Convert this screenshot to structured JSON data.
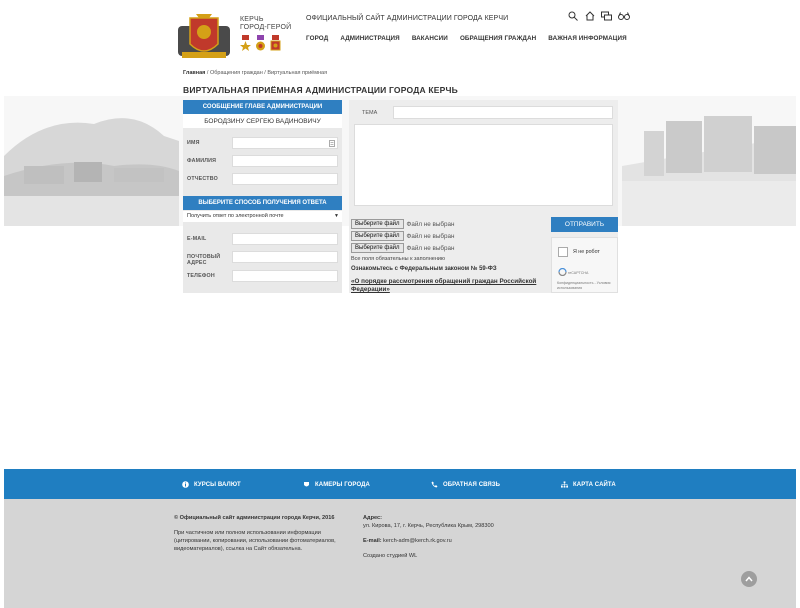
{
  "header": {
    "city_line1": "КЕРЧЬ",
    "city_line2": "ГОРОД-ГЕРОЙ",
    "site_title": "ОФИЦИАЛЬНЫЙ САЙТ АДМИНИСТРАЦИИ ГОРОДА КЕРЧИ",
    "nav": [
      "ГОРОД",
      "АДМИНИСТРАЦИЯ",
      "ВАКАНСИИ",
      "ОБРАЩЕНИЯ ГРАЖДАН",
      "ВАЖНАЯ ИНФОРМАЦИЯ"
    ]
  },
  "breadcrumb": {
    "home": "Главная",
    "sep": "/",
    "item1": "Обращения граждан",
    "item2": "Виртуальная приёмная"
  },
  "page_title": "ВИРТУАЛЬНАЯ ПРИЁМНАЯ АДМИНИСТРАЦИИ ГОРОДА КЕРЧЬ",
  "left_form": {
    "header": "СООБЩЕНИЕ ГЛАВЕ АДМИНИСТРАЦИИ",
    "recipient": "БОРОДЗИНУ СЕРГЕЮ ВАДИНОВИЧУ",
    "label_name": "ИМЯ",
    "label_surname": "ФАМИЛИЯ",
    "label_patronymic": "ОТЧЕСТВО",
    "method_header": "ВЫБЕРИТЕ СПОСОБ ПОЛУЧЕНИЯ ОТВЕТА",
    "method_value": "Получить ответ по электронной почте",
    "label_email": "E-MAIL",
    "label_postal": "ПОЧТОВЫЙ АДРЕС",
    "label_phone": "ТЕЛЕФОН"
  },
  "right_form": {
    "label_topic": "ТЕМА",
    "file_button": "Выберите файл",
    "file_none": "Файл не выбран",
    "send": "ОТПРАВИТЬ",
    "captcha_label": "Я не робот",
    "captcha_brand": "reCAPTCHA",
    "captcha_terms": "Конфиденциальность - Условия использования",
    "required_note": "Все поля обязательны к заполнению",
    "law_note": "Ознакомьтесь с Федеральным законом № 59-ФЗ",
    "law_link": "«О порядке рассмотрения обращений граждан Российской Федерации»"
  },
  "footer": {
    "links": [
      "КУРСЫ ВАЛЮТ",
      "КАМЕРЫ ГОРОДА",
      "ОБРАТНАЯ СВЯЗЬ",
      "КАРТА САЙТА"
    ],
    "copyright": "© Официальный сайт администрации города Керчи, 2016",
    "usage_note": "При частичном или полном использовании информации (цитировании, копировании, использовании фотоматериалов, видеоматериалов), ссылка на Сайт обязательна.",
    "address_label": "Адрес:",
    "address": "ул. Кирова, 17, г. Керчь, Республика Крым, 298300",
    "email_label": "E-mail:",
    "email": "kerch-adm@kerch.rk.gov.ru",
    "studio": "Создано студией WL"
  },
  "colors": {
    "accent": "#2f7fc1",
    "footer_bar": "#1f7ec1",
    "footer_bg": "#d5d5d5"
  }
}
